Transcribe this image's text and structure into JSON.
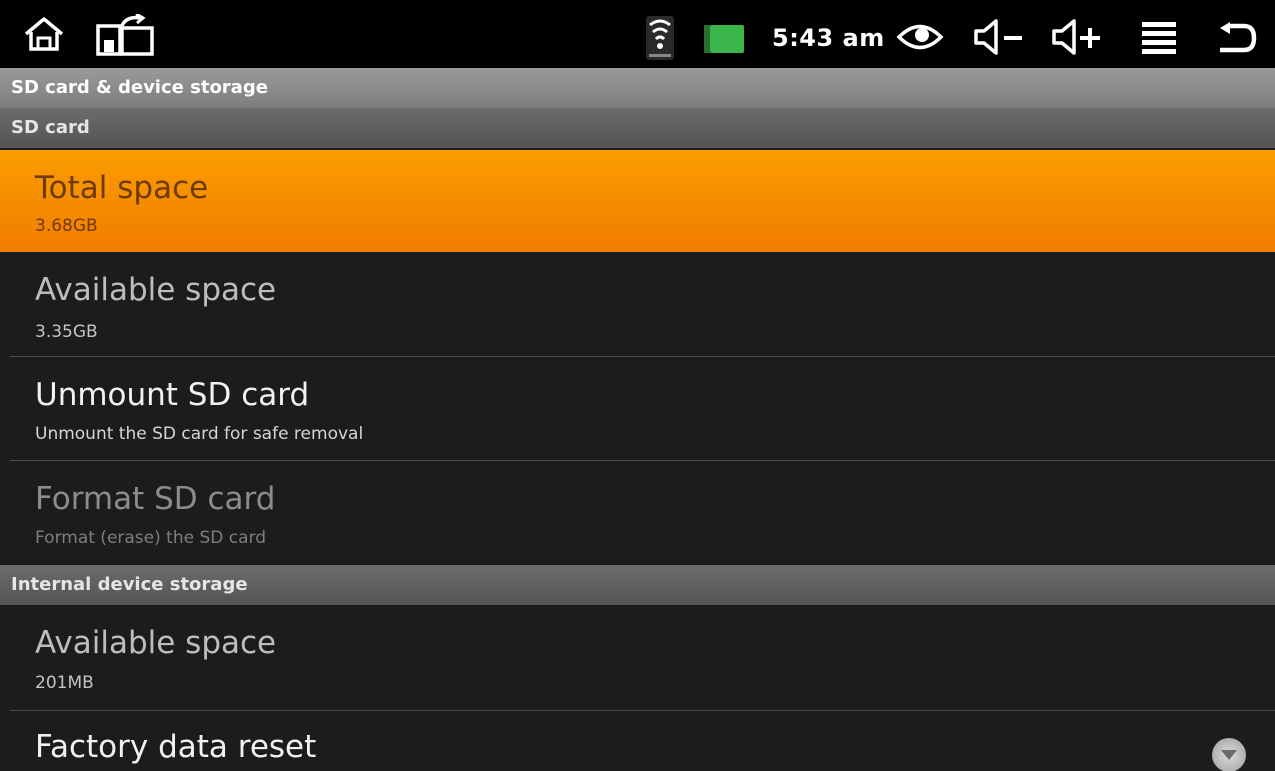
{
  "status_bar": {
    "time": "5:43 am",
    "icons": [
      "home-icon",
      "recent-apps-icon",
      "wifi-icon",
      "battery-icon",
      "eye-icon",
      "volume-down-icon",
      "volume-up-icon",
      "menu-icon",
      "back-icon"
    ],
    "battery_color": "#39b54a"
  },
  "title": "SD card & device storage",
  "sd_card": {
    "header": "SD card",
    "total_space": {
      "title": "Total space",
      "value": "3.68GB"
    },
    "available_space": {
      "title": "Available space",
      "value": "3.35GB"
    },
    "unmount": {
      "title": "Unmount SD card",
      "summary": "Unmount the SD card for safe removal"
    },
    "format": {
      "title": "Format SD card",
      "summary": "Format (erase) the SD card"
    }
  },
  "internal": {
    "header": "Internal device storage",
    "available_space": {
      "title": "Available space",
      "value": "201MB"
    },
    "factory_reset": {
      "title": "Factory data reset"
    }
  },
  "colors": {
    "highlight": "#f58a00",
    "background": "#1c1c1c"
  }
}
